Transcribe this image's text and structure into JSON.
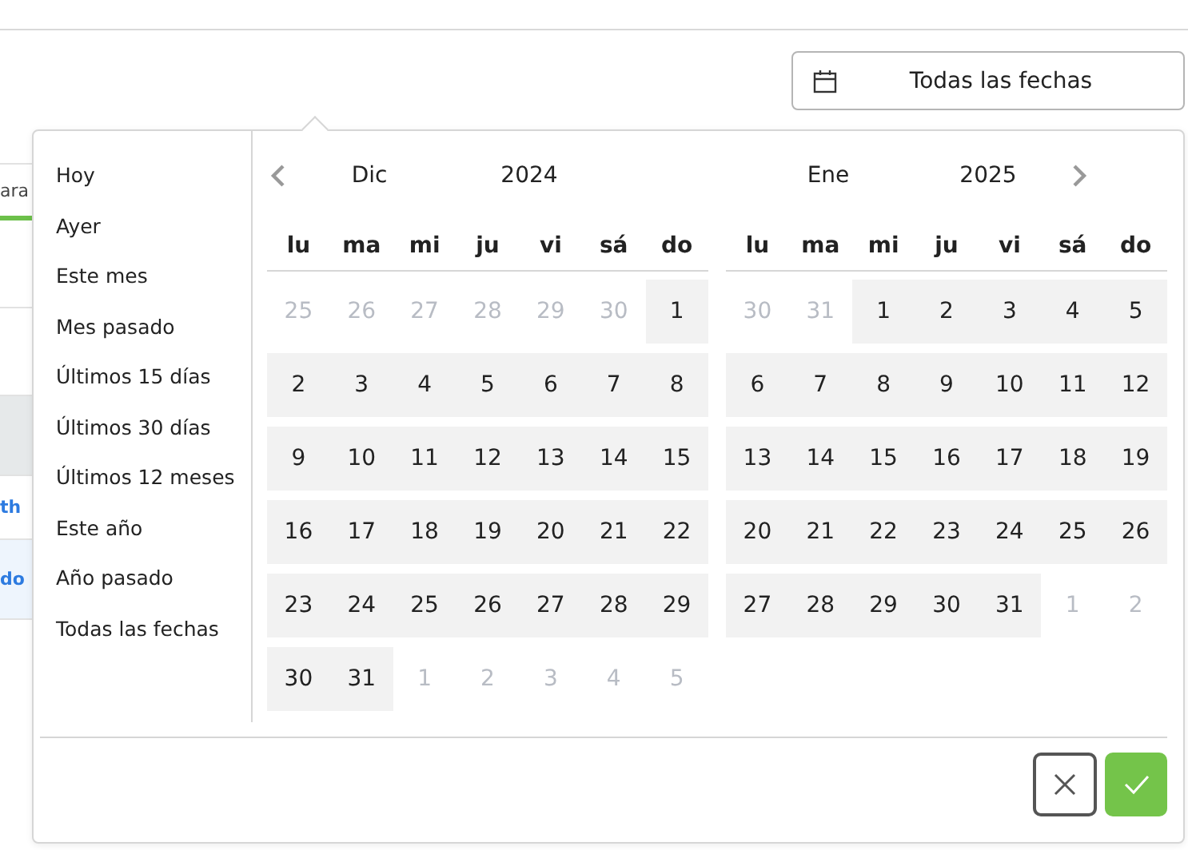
{
  "date_button": {
    "label": "Todas las fechas"
  },
  "background_fragments": [
    {
      "kind": "tab",
      "text": "ara"
    },
    {
      "kind": "link",
      "text": "th"
    },
    {
      "kind": "link-row",
      "text": "do"
    }
  ],
  "presets": [
    {
      "label": "Hoy",
      "selected": false
    },
    {
      "label": "Ayer",
      "selected": false
    },
    {
      "label": "Este mes",
      "selected": false
    },
    {
      "label": "Mes pasado",
      "selected": false
    },
    {
      "label": "Últimos 15 días",
      "selected": false
    },
    {
      "label": "Últimos 30 días",
      "selected": false
    },
    {
      "label": "Últimos 12 meses",
      "selected": false
    },
    {
      "label": "Este año",
      "selected": false
    },
    {
      "label": "Año pasado",
      "selected": false
    },
    {
      "label": "Todas las fechas",
      "selected": false
    }
  ],
  "calendars": [
    {
      "month": "Dic",
      "year": "2024",
      "weekdays": [
        "lu",
        "ma",
        "mi",
        "ju",
        "vi",
        "sá",
        "do"
      ],
      "days": [
        {
          "label": "25",
          "outside": true
        },
        {
          "label": "26",
          "outside": true
        },
        {
          "label": "27",
          "outside": true
        },
        {
          "label": "28",
          "outside": true
        },
        {
          "label": "29",
          "outside": true
        },
        {
          "label": "30",
          "outside": true
        },
        {
          "label": "1",
          "outside": false
        },
        {
          "label": "2",
          "outside": false
        },
        {
          "label": "3",
          "outside": false
        },
        {
          "label": "4",
          "outside": false
        },
        {
          "label": "5",
          "outside": false
        },
        {
          "label": "6",
          "outside": false
        },
        {
          "label": "7",
          "outside": false
        },
        {
          "label": "8",
          "outside": false
        },
        {
          "label": "9",
          "outside": false
        },
        {
          "label": "10",
          "outside": false
        },
        {
          "label": "11",
          "outside": false
        },
        {
          "label": "12",
          "outside": false
        },
        {
          "label": "13",
          "outside": false
        },
        {
          "label": "14",
          "outside": false
        },
        {
          "label": "15",
          "outside": false
        },
        {
          "label": "16",
          "outside": false
        },
        {
          "label": "17",
          "outside": false
        },
        {
          "label": "18",
          "outside": false
        },
        {
          "label": "19",
          "outside": false
        },
        {
          "label": "20",
          "outside": false
        },
        {
          "label": "21",
          "outside": false
        },
        {
          "label": "22",
          "outside": false
        },
        {
          "label": "23",
          "outside": false
        },
        {
          "label": "24",
          "outside": false
        },
        {
          "label": "25",
          "outside": false
        },
        {
          "label": "26",
          "outside": false
        },
        {
          "label": "27",
          "outside": false
        },
        {
          "label": "28",
          "outside": false
        },
        {
          "label": "29",
          "outside": false
        },
        {
          "label": "30",
          "outside": false
        },
        {
          "label": "31",
          "outside": false
        },
        {
          "label": "1",
          "outside": true
        },
        {
          "label": "2",
          "outside": true
        },
        {
          "label": "3",
          "outside": true
        },
        {
          "label": "4",
          "outside": true
        },
        {
          "label": "5",
          "outside": true
        }
      ]
    },
    {
      "month": "Ene",
      "year": "2025",
      "weekdays": [
        "lu",
        "ma",
        "mi",
        "ju",
        "vi",
        "sá",
        "do"
      ],
      "days": [
        {
          "label": "30",
          "outside": true
        },
        {
          "label": "31",
          "outside": true
        },
        {
          "label": "1",
          "outside": false
        },
        {
          "label": "2",
          "outside": false
        },
        {
          "label": "3",
          "outside": false
        },
        {
          "label": "4",
          "outside": false
        },
        {
          "label": "5",
          "outside": false
        },
        {
          "label": "6",
          "outside": false
        },
        {
          "label": "7",
          "outside": false
        },
        {
          "label": "8",
          "outside": false
        },
        {
          "label": "9",
          "outside": false
        },
        {
          "label": "10",
          "outside": false
        },
        {
          "label": "11",
          "outside": false
        },
        {
          "label": "12",
          "outside": false
        },
        {
          "label": "13",
          "outside": false
        },
        {
          "label": "14",
          "outside": false
        },
        {
          "label": "15",
          "outside": false
        },
        {
          "label": "16",
          "outside": false
        },
        {
          "label": "17",
          "outside": false
        },
        {
          "label": "18",
          "outside": false
        },
        {
          "label": "19",
          "outside": false
        },
        {
          "label": "20",
          "outside": false
        },
        {
          "label": "21",
          "outside": false
        },
        {
          "label": "22",
          "outside": false
        },
        {
          "label": "23",
          "outside": false
        },
        {
          "label": "24",
          "outside": false
        },
        {
          "label": "25",
          "outside": false
        },
        {
          "label": "26",
          "outside": false
        },
        {
          "label": "27",
          "outside": false
        },
        {
          "label": "28",
          "outside": false
        },
        {
          "label": "29",
          "outside": false
        },
        {
          "label": "30",
          "outside": false
        },
        {
          "label": "31",
          "outside": false
        },
        {
          "label": "1",
          "outside": true
        },
        {
          "label": "2",
          "outside": true
        }
      ]
    }
  ]
}
